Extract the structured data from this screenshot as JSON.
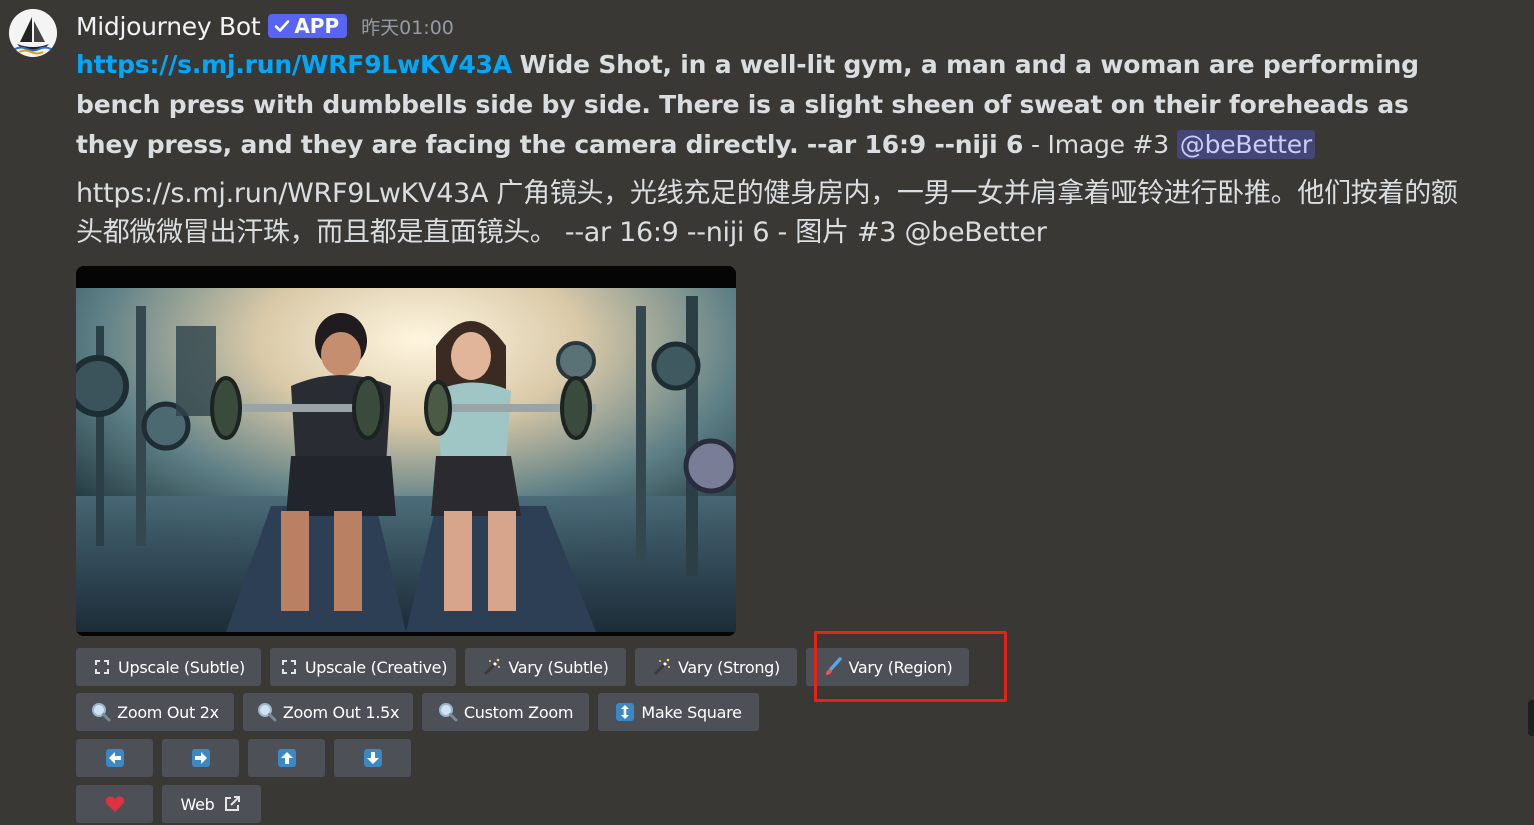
{
  "author": {
    "name": "Midjourney Bot",
    "badge": "APP",
    "timestamp": "昨天01:00"
  },
  "message_en": {
    "link": "https://s.mj.run/WRF9LwKV43A",
    "prompt": "Wide Shot, in a well-lit gym, a man and a woman are performing bench press with dumbbells side by side. There is a slight sheen of sweat on their foreheads as they press, and they are facing the camera directly. --ar 16:9 --niji 6",
    "suffix": " - Image #3 ",
    "mention": "@beBetter"
  },
  "message_zh": {
    "text": "https://s.mj.run/WRF9LwKV43A 广角镜头，光线充足的健身房内，一男一女并肩拿着哑铃进行卧推。他们按着的额头都微微冒出汗珠，而且都是直面镜头。 --ar 16:9 --niji 6 - 图片 #3 @beBetter"
  },
  "buttons": {
    "row1": [
      {
        "label": "Upscale (Subtle)",
        "icon": "upscale-icon"
      },
      {
        "label": "Upscale (Creative)",
        "icon": "upscale-icon"
      },
      {
        "label": "Vary (Subtle)",
        "icon": "magic-wand-icon"
      },
      {
        "label": "Vary (Strong)",
        "icon": "magic-wand-icon"
      },
      {
        "label": "Vary (Region)",
        "icon": "paintbrush-icon"
      }
    ],
    "row2": [
      {
        "label": "Zoom Out 2x",
        "icon": "magnifier-icon"
      },
      {
        "label": "Zoom Out 1.5x",
        "icon": "magnifier-icon"
      },
      {
        "label": "Custom Zoom",
        "icon": "magnifier-icon"
      },
      {
        "label": "Make Square",
        "icon": "up-down-arrow-icon"
      }
    ],
    "row3": [
      {
        "icon": "arrow-left-icon"
      },
      {
        "icon": "arrow-right-icon"
      },
      {
        "icon": "arrow-up-icon"
      },
      {
        "icon": "arrow-down-icon"
      }
    ],
    "row4": [
      {
        "icon": "heart-icon"
      },
      {
        "label": "Web",
        "icon": "external-link-icon"
      }
    ]
  },
  "colors": {
    "background": "#3a3834",
    "link": "#00a8fc",
    "button": "#4e5058",
    "highlight": "#e62117",
    "badge": "#5865f2"
  }
}
